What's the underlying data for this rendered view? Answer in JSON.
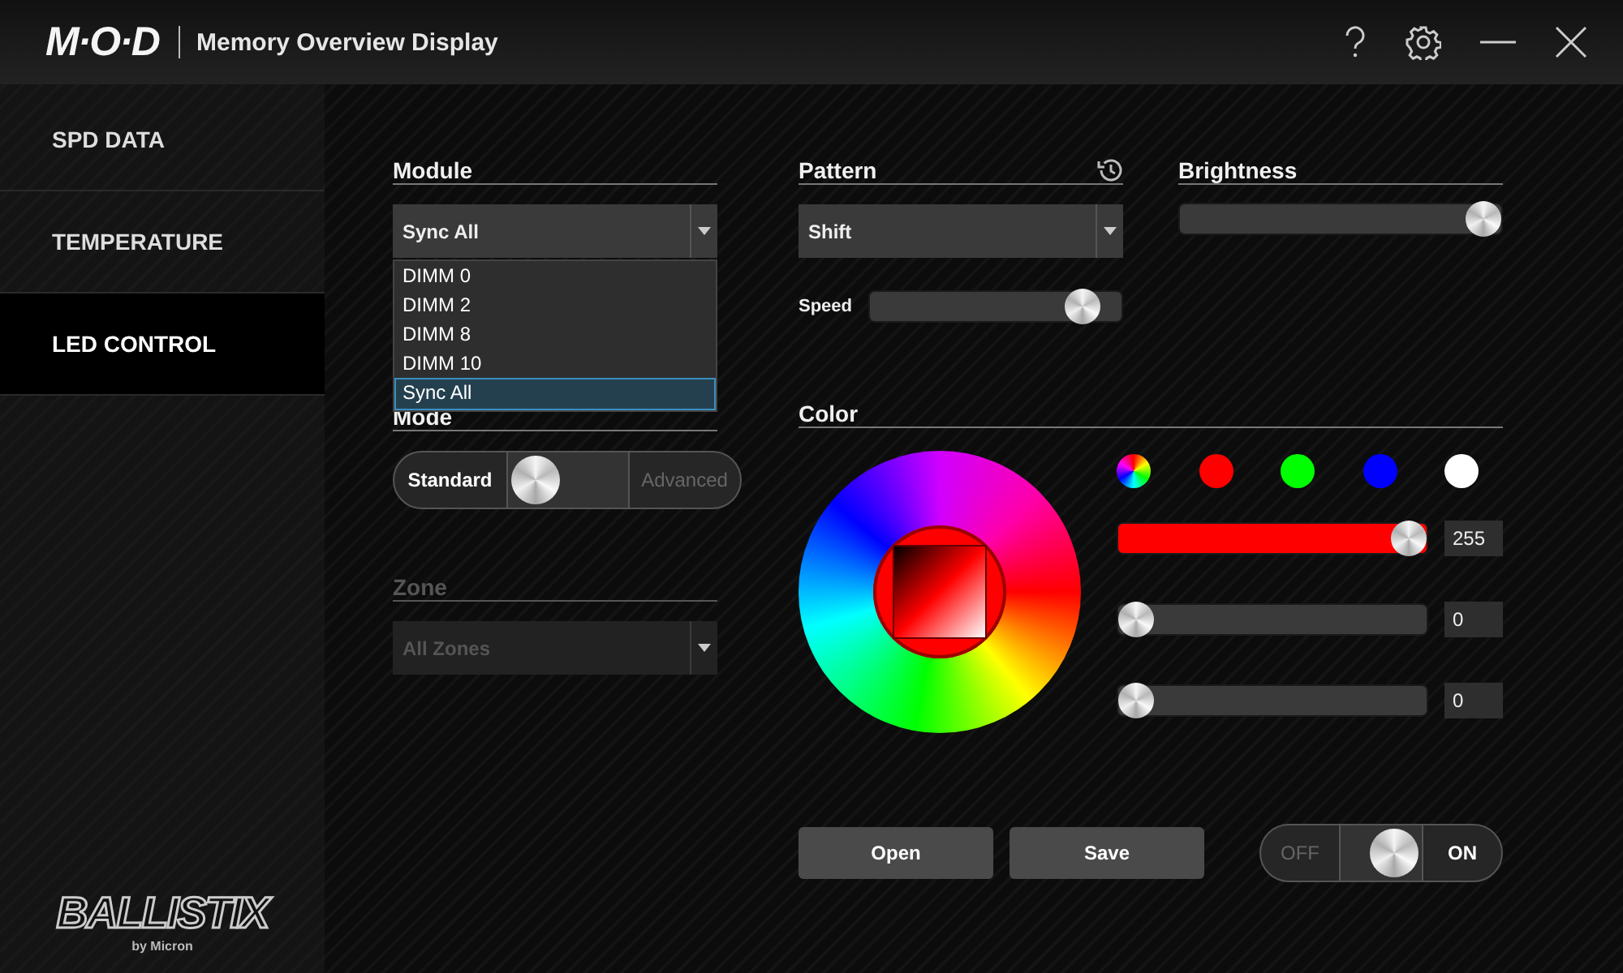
{
  "title_bar": {
    "logo": "M·O·D",
    "title": "Memory Overview Display"
  },
  "sidebar": {
    "items": [
      {
        "label": "SPD DATA",
        "selected": false
      },
      {
        "label": "TEMPERATURE",
        "selected": false
      },
      {
        "label": "LED CONTROL",
        "selected": true
      }
    ],
    "brand": {
      "logo": "BALLISTIX",
      "tagline": "by Micron"
    }
  },
  "module": {
    "heading": "Module",
    "value": "Sync All",
    "options": [
      {
        "label": "DIMM 0",
        "selected": false
      },
      {
        "label": "DIMM 2",
        "selected": false
      },
      {
        "label": "DIMM 8",
        "selected": false
      },
      {
        "label": "DIMM 10",
        "selected": false
      },
      {
        "label": "Sync All",
        "selected": true
      }
    ]
  },
  "mode": {
    "heading": "Mode",
    "options": [
      {
        "label": "Standard",
        "selected": true
      },
      {
        "label": "Advanced",
        "selected": false
      }
    ]
  },
  "zone": {
    "heading": "Zone",
    "value": "All Zones",
    "disabled": true
  },
  "pattern": {
    "heading": "Pattern",
    "value": "Shift",
    "speed": {
      "label": "Speed",
      "level": 0.9
    }
  },
  "brightness": {
    "heading": "Brightness",
    "level": 1
  },
  "color": {
    "heading": "Color",
    "swatches": [
      {
        "kind": "spectrum"
      },
      {
        "kind": "solid",
        "color": "#ff0000"
      },
      {
        "kind": "solid",
        "color": "#00ff00"
      },
      {
        "kind": "solid",
        "color": "#0000ff"
      },
      {
        "kind": "solid",
        "color": "#ffffff"
      }
    ],
    "channels": [
      {
        "level": 1,
        "reading": "255"
      },
      {
        "level": 0,
        "reading": "0"
      },
      {
        "level": 0,
        "reading": "0"
      }
    ]
  },
  "buttons": [
    "Open",
    "Save"
  ],
  "power": {
    "off_label": "OFF",
    "on_label": "ON",
    "on": true
  }
}
